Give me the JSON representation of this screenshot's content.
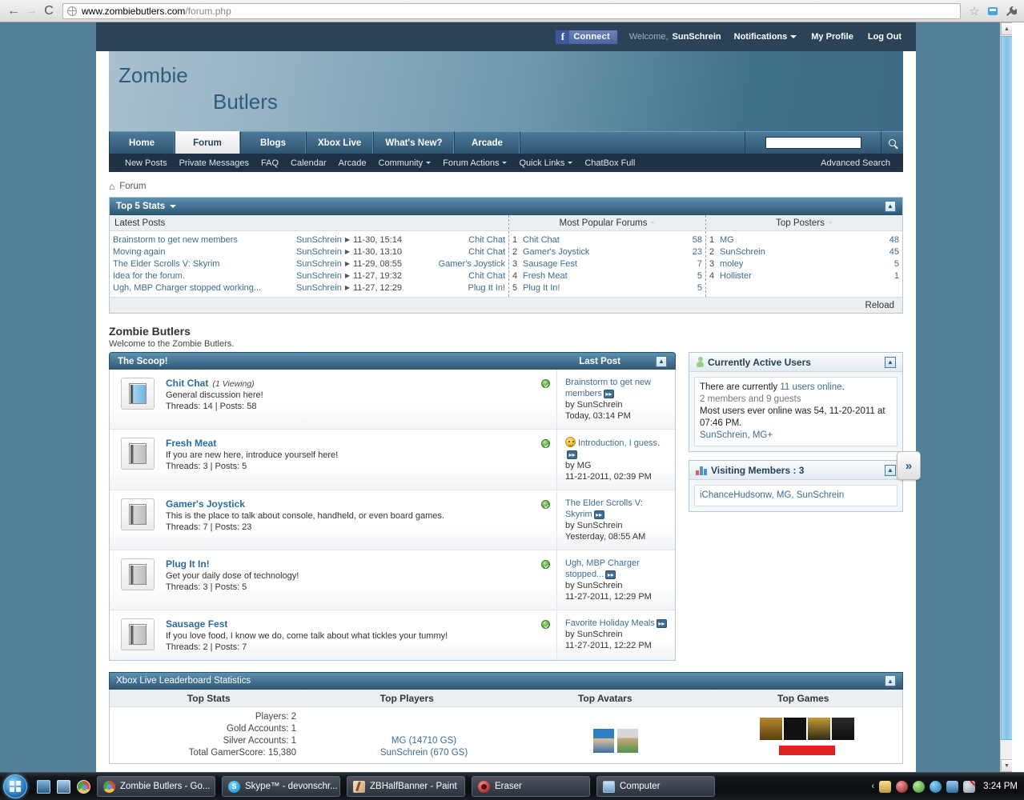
{
  "browser": {
    "url_main": "www.zombiebutlers.com",
    "url_path": "/forum.php",
    "back_icon": "←",
    "forward_icon": "→",
    "reload_icon": "C",
    "star_icon": "☆"
  },
  "topbar": {
    "fb_label": "Connect",
    "fb_f": "f",
    "welcome_label": "Welcome,",
    "username": "SunSchrein",
    "notifications": "Notifications",
    "my_profile": "My Profile",
    "log_out": "Log Out"
  },
  "banner": {
    "line1": "Zombie",
    "line2": "Butlers"
  },
  "nav": {
    "tabs": [
      {
        "label": "Home",
        "active": false
      },
      {
        "label": "Forum",
        "active": true
      },
      {
        "label": "Blogs",
        "active": false
      },
      {
        "label": "Xbox Live",
        "active": false
      },
      {
        "label": "What's New?",
        "active": false
      },
      {
        "label": "Arcade",
        "active": false
      }
    ],
    "search_value": "",
    "search_placeholder": "",
    "subnav": [
      {
        "label": "New Posts",
        "caret": false
      },
      {
        "label": "Private Messages",
        "caret": false
      },
      {
        "label": "FAQ",
        "caret": false
      },
      {
        "label": "Calendar",
        "caret": false
      },
      {
        "label": "Arcade",
        "caret": false
      },
      {
        "label": "Community",
        "caret": true
      },
      {
        "label": "Forum Actions",
        "caret": true
      },
      {
        "label": "Quick Links",
        "caret": true
      },
      {
        "label": "ChatBox Full",
        "caret": false
      }
    ],
    "advanced_search": "Advanced Search"
  },
  "breadcrumb": {
    "home_icon": "⌂",
    "label": "Forum"
  },
  "top5": {
    "title": "Top 5 Stats",
    "collapse_icon": "▲",
    "col_latest": "Latest Posts",
    "col_popular": "Most Popular Forums",
    "col_posters": "Top Posters",
    "reload": "Reload",
    "latest_posts": [
      {
        "title": "Brainstorm to get new members",
        "user": "SunSchrein",
        "date": "11-30, 15:14",
        "forum": "Chit Chat"
      },
      {
        "title": "Moving again",
        "user": "SunSchrein",
        "date": "11-30, 13:10",
        "forum": "Chit Chat"
      },
      {
        "title": "The Elder Scrolls V: Skyrim",
        "user": "SunSchrein",
        "date": "11-29, 08:55",
        "forum": "Gamer's Joystick"
      },
      {
        "title": "Idea for the forum.",
        "user": "SunSchrein",
        "date": "11-27, 19:32",
        "forum": "Chit Chat"
      },
      {
        "title": "Ugh, MBP Charger stopped working...",
        "user": "SunSchrein",
        "date": "11-27, 12:29",
        "forum": "Plug It In!"
      }
    ],
    "popular_forums": [
      {
        "rank": "1",
        "name": "Chit Chat",
        "count": "58"
      },
      {
        "rank": "2",
        "name": "Gamer's Joystick",
        "count": "23"
      },
      {
        "rank": "3",
        "name": "Sausage Fest",
        "count": "7"
      },
      {
        "rank": "4",
        "name": "Fresh Meat",
        "count": "5"
      },
      {
        "rank": "5",
        "name": "Plug It In!",
        "count": "5"
      }
    ],
    "top_posters": [
      {
        "rank": "1",
        "name": "MG",
        "count": "48"
      },
      {
        "rank": "2",
        "name": "SunSchrein",
        "count": "45"
      },
      {
        "rank": "3",
        "name": "moley",
        "count": "5"
      },
      {
        "rank": "4",
        "name": "Hollister",
        "count": "1"
      }
    ]
  },
  "forum_heading": {
    "title": "Zombie Butlers",
    "subtitle": "Welcome to the Zombie Butlers."
  },
  "scoop": {
    "title": "The Scoop!",
    "last_post_header": "Last Post",
    "collapse_icon": "▲",
    "forums": [
      {
        "name": "Chit Chat",
        "viewing": "(1 Viewing)",
        "desc": "General discussion here!",
        "counts": "Threads: 14 | Posts: 58",
        "icon": "book-blue-icon",
        "status": "read-status-icon",
        "last_title": "Brainstorm to get new members",
        "last_smiley": false,
        "last_by": "by SunSchrein",
        "last_by_user": "SunSchrein",
        "last_stamp": "Today, 03:14 PM"
      },
      {
        "name": "Fresh Meat",
        "viewing": "",
        "desc": "If you are new here, introduce yourself here!",
        "counts": "Threads: 3 | Posts: 5",
        "icon": "book-gray-icon",
        "status": "read-status-icon",
        "last_title": "Introduction, I guess.",
        "last_smiley": true,
        "last_by": "by MG",
        "last_by_user": "MG",
        "last_stamp": "11-21-2011, 02:39 PM"
      },
      {
        "name": "Gamer's Joystick",
        "viewing": "",
        "desc": "This is the place to talk about console, handheld, or even board games.",
        "counts": "Threads: 7 | Posts: 23",
        "icon": "book-gray-icon",
        "status": "read-status-icon",
        "last_title": "The Elder Scrolls V: Skyrim",
        "last_smiley": false,
        "last_by": "by SunSchrein",
        "last_by_user": "SunSchrein",
        "last_stamp": "Yesterday, 08:55 AM"
      },
      {
        "name": "Plug It In!",
        "viewing": "",
        "desc": "Get your daily dose of technology!",
        "counts": "Threads: 3 | Posts: 5",
        "icon": "book-gray-icon",
        "status": "read-status-icon",
        "last_title": "Ugh, MBP Charger stopped...",
        "last_smiley": false,
        "last_by": "by SunSchrein",
        "last_by_user": "SunSchrein",
        "last_stamp": "11-27-2011, 12:29 PM"
      },
      {
        "name": "Sausage Fest",
        "viewing": "",
        "desc": "If you love food, I know we do, come talk about what tickles your tummy!",
        "counts": "Threads: 2 | Posts: 7",
        "icon": "book-gray-icon",
        "status": "read-status-icon",
        "last_title": "Favorite Holiday Meals",
        "last_smiley": false,
        "last_by": "by SunSchrein",
        "last_by_user": "SunSchrein",
        "last_stamp": "11-27-2011, 12:22 PM"
      }
    ]
  },
  "sidebar": {
    "active_users": {
      "title": "Currently Active Users",
      "collapse_icon": "▲",
      "line1_prefix": "There are currently ",
      "line1_count": "11 users online",
      "line1_suffix": ".",
      "line2": "2 members and 9 guests",
      "line3": "Most users ever online was 54, 11-20-2011 at 07:46 PM.",
      "line4": "SunSchrein, MG+"
    },
    "visiting_members": {
      "title": "Visiting Members : 3",
      "collapse_icon": "▲",
      "members": "iChanceHudsonw, MG, SunSchrein"
    },
    "expand_tab_icon": "»"
  },
  "xbox": {
    "title": "Xbox Live Leaderboard Statistics",
    "collapse_icon": "▲",
    "columns": [
      "Top Stats",
      "Top Players",
      "Top Avatars",
      "Top Games"
    ],
    "stats": [
      "Players: 2",
      "Gold Accounts: 1",
      "Silver Accounts: 1",
      "Total GamerScore: 15,380"
    ],
    "players": [
      "MG (14710 GS)",
      "SunSchrein (670 GS)"
    ]
  },
  "taskbar": {
    "start_label": "Start",
    "items": [
      {
        "label": "Zombie Butlers - Go...",
        "icon": "chrome"
      },
      {
        "label": "Skype™ - devonschr...",
        "icon": "skype"
      },
      {
        "label": "ZBHalfBanner - Paint",
        "icon": "paint"
      },
      {
        "label": "Eraser",
        "icon": "eraser"
      },
      {
        "label": "Computer",
        "icon": "computer"
      }
    ],
    "tray_chevron": "‹",
    "clock": "3:24 PM"
  }
}
